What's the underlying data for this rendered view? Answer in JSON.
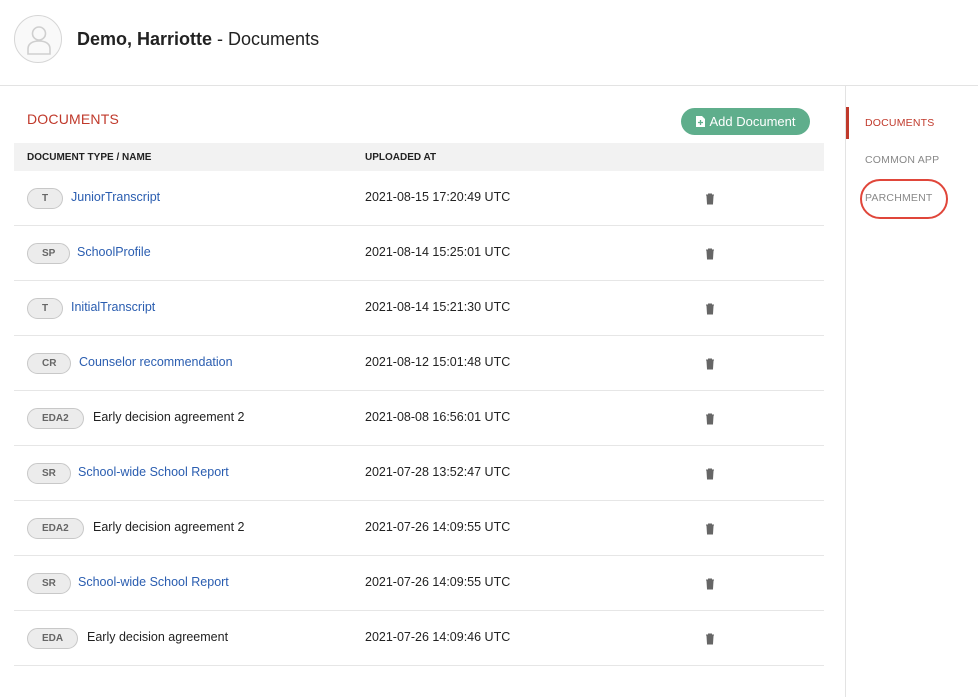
{
  "header": {
    "name": "Demo, Harriotte",
    "separator": " - ",
    "section": "Documents"
  },
  "main": {
    "section_title": "DOCUMENTS",
    "add_button_label": "Add Document",
    "columns": {
      "type_name": "DOCUMENT TYPE / NAME",
      "uploaded_at": "UPLOADED AT"
    },
    "rows": [
      {
        "badge": "T",
        "name": "JuniorTranscript",
        "linked": true,
        "uploaded": "2021-08-15 17:20:49 UTC"
      },
      {
        "badge": "SP",
        "name": "SchoolProfile",
        "linked": true,
        "uploaded": "2021-08-14 15:25:01 UTC"
      },
      {
        "badge": "T",
        "name": "InitialTranscript",
        "linked": true,
        "uploaded": "2021-08-14 15:21:30 UTC"
      },
      {
        "badge": "CR",
        "name": "Counselor recommendation",
        "linked": true,
        "uploaded": "2021-08-12 15:01:48 UTC"
      },
      {
        "badge": "EDA2",
        "name": "Early decision agreement 2",
        "linked": false,
        "uploaded": "2021-08-08 16:56:01 UTC"
      },
      {
        "badge": "SR",
        "name": "School-wide School Report",
        "linked": true,
        "uploaded": "2021-07-28 13:52:47 UTC"
      },
      {
        "badge": "EDA2",
        "name": "Early decision agreement 2",
        "linked": false,
        "uploaded": "2021-07-26 14:09:55 UTC"
      },
      {
        "badge": "SR",
        "name": "School-wide School Report",
        "linked": true,
        "uploaded": "2021-07-26 14:09:55 UTC"
      },
      {
        "badge": "EDA",
        "name": "Early decision agreement",
        "linked": false,
        "uploaded": "2021-07-26 14:09:46 UTC"
      }
    ]
  },
  "sidebar": {
    "items": [
      {
        "label": "DOCUMENTS",
        "active": true
      },
      {
        "label": "COMMON APP",
        "active": false
      },
      {
        "label": "PARCHMENT",
        "active": false
      }
    ]
  },
  "icons": {
    "avatar": "user-avatar-icon",
    "add": "document-plus-icon",
    "delete": "trash-icon"
  },
  "colors": {
    "accent": "#c0392b",
    "link": "#2a5db0",
    "add_button": "#5fae8c",
    "highlight_ring": "#e0463a"
  }
}
